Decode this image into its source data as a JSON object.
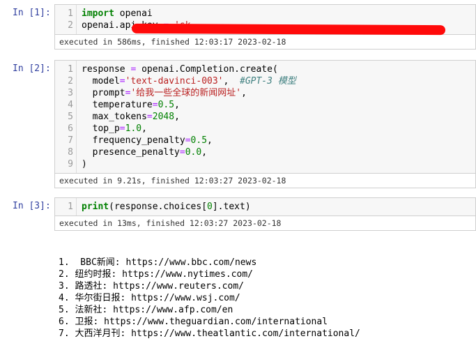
{
  "cells": [
    {
      "prompt": "In [1]:",
      "lines": [
        {
          "n": "1",
          "parts": [
            {
              "t": "import",
              "c": "kw"
            },
            {
              "t": " openai",
              "c": ""
            }
          ]
        },
        {
          "n": "2",
          "parts": [
            {
              "t": "openai.api_key ",
              "c": ""
            },
            {
              "t": "=",
              "c": "op"
            },
            {
              "t": " ",
              "c": ""
            },
            {
              "t": "'sk-",
              "c": "str"
            }
          ]
        }
      ],
      "status": "executed in 586ms, finished 12:03:17 2023-02-18"
    },
    {
      "prompt": "In [2]:",
      "lines": [
        {
          "n": "1",
          "parts": [
            {
              "t": "response ",
              "c": ""
            },
            {
              "t": "=",
              "c": "op"
            },
            {
              "t": " openai.Completion.create(",
              "c": ""
            }
          ]
        },
        {
          "n": "2",
          "parts": [
            {
              "t": "  model",
              "c": ""
            },
            {
              "t": "=",
              "c": "op"
            },
            {
              "t": "'text-davinci-003'",
              "c": "str"
            },
            {
              "t": ",  ",
              "c": ""
            },
            {
              "t": "#GPT-3 模型",
              "c": "comment"
            }
          ]
        },
        {
          "n": "3",
          "parts": [
            {
              "t": "  prompt",
              "c": ""
            },
            {
              "t": "=",
              "c": "op"
            },
            {
              "t": "'给我一些全球的新闻网址'",
              "c": "str"
            },
            {
              "t": ",",
              "c": ""
            }
          ]
        },
        {
          "n": "4",
          "parts": [
            {
              "t": "  temperature",
              "c": ""
            },
            {
              "t": "=",
              "c": "op"
            },
            {
              "t": "0.5",
              "c": "num"
            },
            {
              "t": ",",
              "c": ""
            }
          ]
        },
        {
          "n": "5",
          "parts": [
            {
              "t": "  max_tokens",
              "c": ""
            },
            {
              "t": "=",
              "c": "op"
            },
            {
              "t": "2048",
              "c": "num"
            },
            {
              "t": ",",
              "c": ""
            }
          ]
        },
        {
          "n": "6",
          "parts": [
            {
              "t": "  top_p",
              "c": ""
            },
            {
              "t": "=",
              "c": "op"
            },
            {
              "t": "1.0",
              "c": "num"
            },
            {
              "t": ",",
              "c": ""
            }
          ]
        },
        {
          "n": "7",
          "parts": [
            {
              "t": "  frequency_penalty",
              "c": ""
            },
            {
              "t": "=",
              "c": "op"
            },
            {
              "t": "0.5",
              "c": "num"
            },
            {
              "t": ",",
              "c": ""
            }
          ]
        },
        {
          "n": "8",
          "parts": [
            {
              "t": "  presence_penalty",
              "c": ""
            },
            {
              "t": "=",
              "c": "op"
            },
            {
              "t": "0.0",
              "c": "num"
            },
            {
              "t": ",",
              "c": ""
            }
          ]
        },
        {
          "n": "9",
          "parts": [
            {
              "t": ")",
              "c": ""
            }
          ]
        }
      ],
      "status": "executed in 9.21s, finished 12:03:27 2023-02-18"
    },
    {
      "prompt": "In [3]:",
      "lines": [
        {
          "n": "1",
          "parts": [
            {
              "t": "print",
              "c": "kw"
            },
            {
              "t": "(response.choices[",
              "c": ""
            },
            {
              "t": "0",
              "c": "num"
            },
            {
              "t": "].text)",
              "c": ""
            }
          ]
        }
      ],
      "status": "executed in 13ms, finished 12:03:27 2023-02-18"
    }
  ],
  "output": [
    "1.  BBC新闻: https://www.bbc.com/news",
    "2. 纽约时报: https://www.nytimes.com/",
    "3. 路透社: https://www.reuters.com/",
    "4. 华尔街日报: https://www.wsj.com/",
    "5. 法新社: https://www.afp.com/en",
    "6. 卫报: https://www.theguardian.com/international",
    "7. 大西洋月刊: https://www.theatlantic.com/international/"
  ],
  "colors": {
    "prompt": "#303f9f",
    "keyword": "#008000",
    "string": "#ba2121",
    "comment": "#408080",
    "redaction": "#ff0a0a"
  }
}
